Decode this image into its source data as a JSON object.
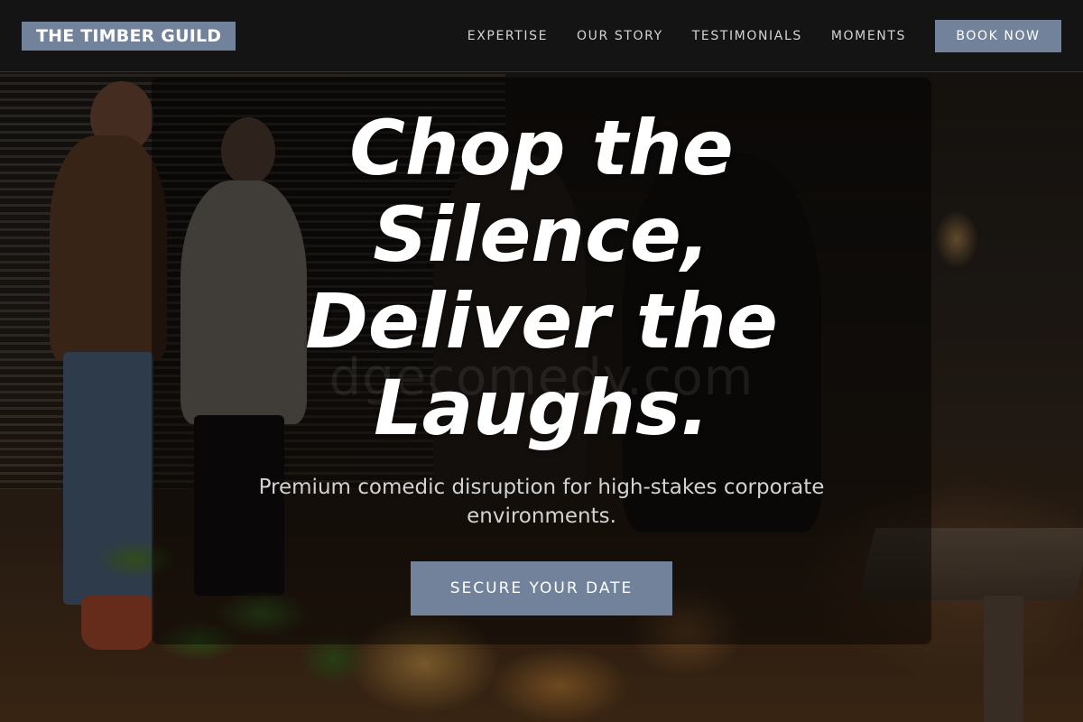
{
  "nav": {
    "brand": "THE TIMBER GUILD",
    "links": [
      "EXPERTISE",
      "OUR STORY",
      "TESTIMONIALS",
      "MOMENTS"
    ],
    "cta_label": "BOOK NOW"
  },
  "hero": {
    "title_lines": [
      "Chop the",
      "Silence,",
      "Deliver the",
      "Laughs."
    ],
    "subtitle": "Premium comedic disruption for high-stakes corporate environments.",
    "cta_label": "SECURE YOUR DATE",
    "watermark": "dgecomedy.com"
  },
  "colors": {
    "accent": "#71829a",
    "nav_background": "#151414",
    "title_text": "#ffffff",
    "subtitle_text": "#d2d2d2"
  },
  "background_image": "dimly lit evening gathering with people standing around a wooden table with candles and a potted plant"
}
